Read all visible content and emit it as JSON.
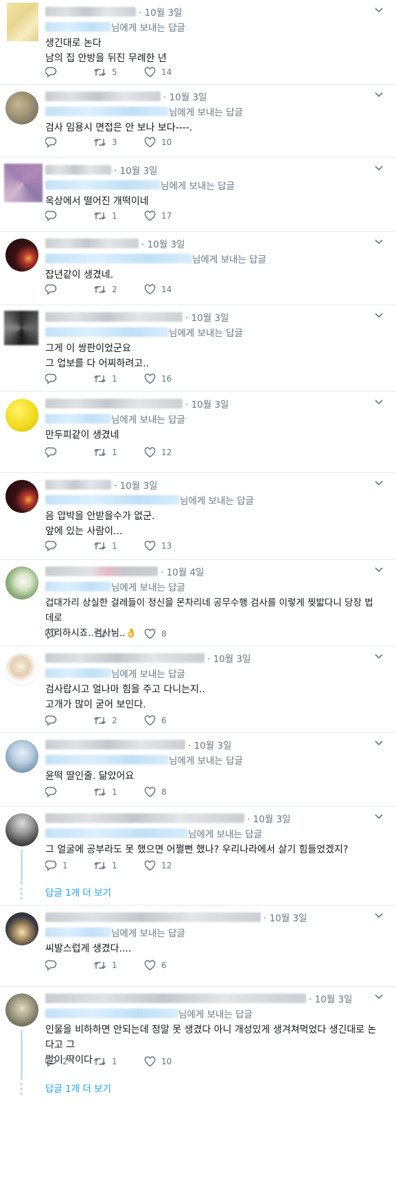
{
  "reply_prefix": "님에게 보내는 답글",
  "icons": {
    "reply": "reply-icon",
    "retweet": "retweet-icon",
    "like": "heart-icon",
    "caret": "chevron-down-icon"
  },
  "colors": {
    "text": "#14171a",
    "secondary": "#657786",
    "link": "#1da1f2",
    "divider": "#e6ecf0"
  },
  "tweets": [
    {
      "date": "· 10월 3일",
      "reply_suffix": "님에게 보내는 답글",
      "lines": [
        "생긴대로 논다",
        "남의 집 안방을 뒤진 무례한 년"
      ],
      "replies": "",
      "retweets": "5",
      "likes": "14",
      "more": ""
    },
    {
      "date": "· 10월 3일",
      "reply_suffix": "님에게 보내는 답글",
      "lines": [
        "검사 임용시 면접은 안 보나 보다----."
      ],
      "replies": "",
      "retweets": "3",
      "likes": "10",
      "more": ""
    },
    {
      "date": "· 10월 3일",
      "reply_suffix": "님에게 보내는 답글",
      "lines": [
        "옥상에서 떨어진 개떡이네"
      ],
      "replies": "",
      "retweets": "1",
      "likes": "17",
      "more": ""
    },
    {
      "date": "· 10월 3일",
      "reply_suffix": "님에게 보내는 답글",
      "lines": [
        "잡년같이 생겼네."
      ],
      "replies": "",
      "retweets": "2",
      "likes": "14",
      "more": ""
    },
    {
      "date": "· 10월 3일",
      "reply_suffix": "님에게 보내는 답글",
      "lines": [
        "그게 이 쌍판이었군요",
        "그 업보를 다 어찌하려고.."
      ],
      "replies": "",
      "retweets": "1",
      "likes": "16",
      "more": ""
    },
    {
      "date": "· 10월 3일",
      "reply_suffix": "님에게 보내는 답글",
      "lines": [
        "만두피같이 생겼네"
      ],
      "replies": "",
      "retweets": "1",
      "likes": "12",
      "more": ""
    },
    {
      "date": "· 10월 3일",
      "reply_suffix": "님에게 보내는 답글",
      "lines": [
        "음 압박을 안받을수가 없군.",
        "앞에 있는 사람이..."
      ],
      "replies": "",
      "retweets": "1",
      "likes": "13",
      "more": ""
    },
    {
      "date": "· 10월 4일",
      "reply_suffix": "님에게 보내는 답글",
      "lines": [
        "겁대가리 상실한 걸레들이 정신을 몬차리네 공무수행 검사를 이렇게 찢밟다니 당장 법데로",
        "처리하시죠..검사님..👌"
      ],
      "replies": "",
      "retweets": "2",
      "likes": "8",
      "more": ""
    },
    {
      "date": "· 10월 3일",
      "reply_suffix": "님에게 보내는 답글",
      "lines": [
        "검사랍시고 얼나마 힘을 주고 다니는지..",
        "고개가 많이 굳어 보인다."
      ],
      "replies": "",
      "retweets": "2",
      "likes": "6",
      "more": ""
    },
    {
      "date": "· 10월 3일",
      "reply_suffix": "님에게 보내는 답글",
      "lines": [
        "윤떡 딸인줄. 닮았어요"
      ],
      "replies": "",
      "retweets": "1",
      "likes": "8",
      "more": ""
    },
    {
      "date": "· 10월 3일",
      "reply_suffix": "님에게 보내는 답글",
      "lines": [
        "그 얼굴에 공부라도 못 했으면 어쩔뻔 했나? 우리나라에서 살기 힘들었겠지?"
      ],
      "replies": "1",
      "retweets": "1",
      "likes": "12",
      "more": "답글 1개 더 보기"
    },
    {
      "date": "· 10월 3일",
      "reply_suffix": "님에게 보내는 답글",
      "lines": [
        "씨발스럽게 생겼다...."
      ],
      "replies": "",
      "retweets": "1",
      "likes": "6",
      "more": ""
    },
    {
      "date": "· 10월 3일",
      "reply_suffix": "님에게 보내는 답글",
      "lines": [
        "인물을 비하하면 안되는데 정말 못 생겼다 아니 개성있게 생겨쳐먹었다 생긴대로 논다고 그",
        "말이 딱이다"
      ],
      "replies": "2",
      "retweets": "1",
      "likes": "10",
      "more": "답글 1개 더 보기"
    }
  ]
}
